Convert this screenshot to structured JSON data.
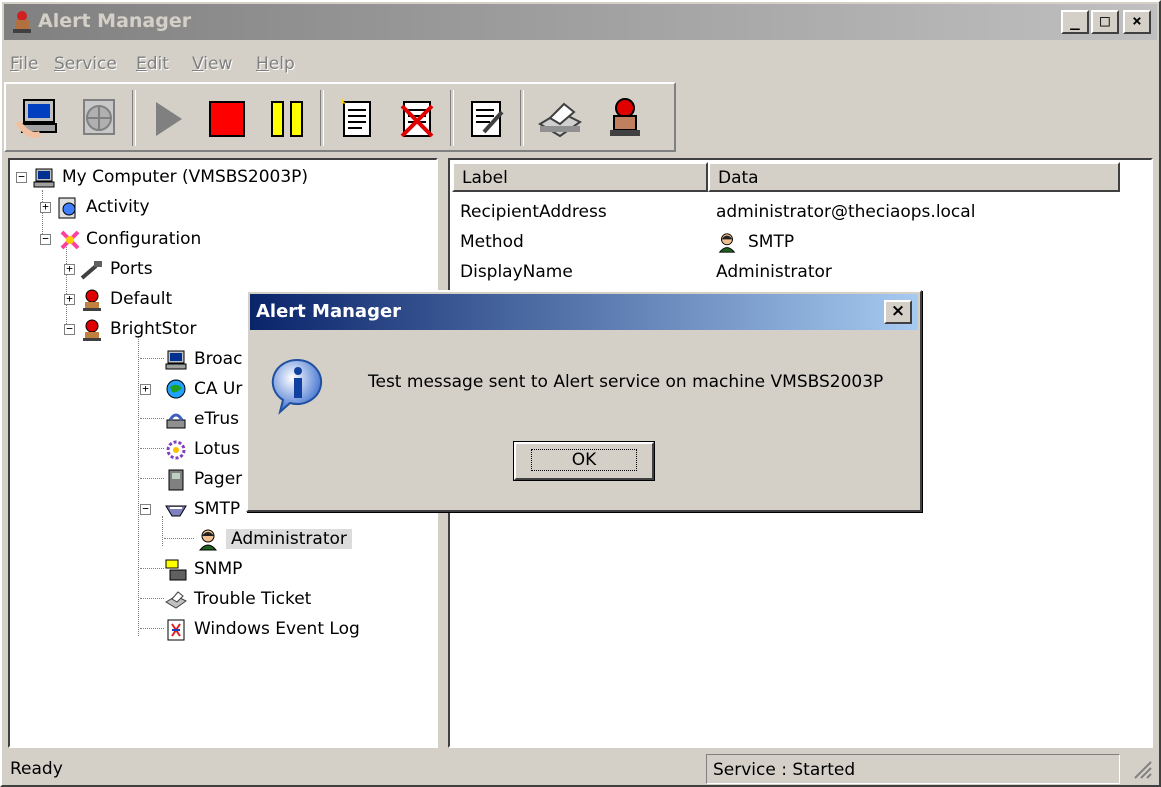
{
  "window": {
    "title": "Alert Manager",
    "buttons": {
      "minimize": "_",
      "maximize": "□",
      "close": "×"
    }
  },
  "menu": [
    {
      "label": "File",
      "key": "F"
    },
    {
      "label": "Service",
      "key": "S"
    },
    {
      "label": "Edit",
      "key": "E"
    },
    {
      "label": "View",
      "key": "V"
    },
    {
      "label": "Help",
      "key": "H"
    }
  ],
  "toolbar": {
    "buttons": [
      "connect-computer",
      "disconnect",
      "start-service",
      "stop-service",
      "pause-service",
      "new-item",
      "delete-item",
      "properties",
      "test-message",
      "alert-help"
    ]
  },
  "tree": {
    "items": [
      {
        "label": "My Computer (VMSBS2003P)",
        "icon": "computer-icon",
        "expander": "−"
      },
      {
        "label": "Activity",
        "icon": "activity-icon",
        "expander": "+"
      },
      {
        "label": "Configuration",
        "icon": "configuration-icon",
        "expander": "−"
      },
      {
        "label": "Ports",
        "icon": "ports-icon",
        "expander": "+"
      },
      {
        "label": "Default",
        "icon": "alert-lamp-icon",
        "expander": "+"
      },
      {
        "label": "BrightStor",
        "icon": "alert-lamp-icon",
        "expander": "−"
      },
      {
        "label": "Broac",
        "icon": "broadcast-icon"
      },
      {
        "label": "CA Ur",
        "icon": "globe-icon",
        "expander": "+"
      },
      {
        "label": "eTrus",
        "icon": "etrust-icon"
      },
      {
        "label": "Lotus",
        "icon": "lotus-icon"
      },
      {
        "label": "Pager",
        "icon": "pager-icon"
      },
      {
        "label": "SMTP",
        "icon": "smtp-icon",
        "expander": "−"
      },
      {
        "label": "Administrator",
        "icon": "user-icon"
      },
      {
        "label": "SNMP",
        "icon": "snmp-icon"
      },
      {
        "label": "Trouble Ticket",
        "icon": "printer-icon"
      },
      {
        "label": "Windows Event Log",
        "icon": "event-log-icon"
      }
    ]
  },
  "list": {
    "columns": [
      "Label",
      "Data"
    ],
    "rows": [
      {
        "label": "RecipientAddress",
        "data": "administrator@theciaops.local"
      },
      {
        "label": "Method",
        "data": "SMTP",
        "icon": "user-icon"
      },
      {
        "label": "DisplayName",
        "data": "Administrator"
      }
    ]
  },
  "dialog": {
    "title": "Alert Manager",
    "message": "Test message sent to Alert service on machine VMSBS2003P",
    "ok_label": "OK",
    "close": "×"
  },
  "status": {
    "left": "Ready",
    "right": "Service : Started"
  }
}
